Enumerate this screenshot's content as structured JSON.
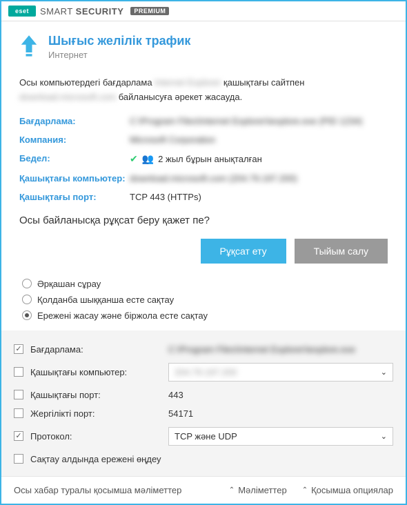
{
  "titlebar": {
    "eset": "eset",
    "brand_plain": "SMART ",
    "brand_bold": "SECURITY",
    "premium": "PREMIUM"
  },
  "header": {
    "title": "Шығыс желілік трафик",
    "subtitle": "Интернет"
  },
  "description": {
    "part1": "Осы компьютердегі бағдарлама ",
    "app_blurred": "Internet Explorer",
    "part2": " қашықтағы сайтпен ",
    "site_blurred": "download.microsoft.com",
    "part3": " байланысуға әрекет жасауда."
  },
  "info": {
    "app_label": "Бағдарлама:",
    "app_value": "C:\\Program Files\\Internet Explorer\\iexplore.exe (PID 1234)",
    "company_label": "Компания:",
    "company_value": "Microsoft Corporation",
    "rep_label": "Бедел:",
    "rep_value": "2 жыл бұрын анықталған",
    "remote_comp_label": "Қашықтағы компьютер:",
    "remote_comp_value": "download.microsoft.com (204.79.197.200)",
    "remote_port_label": "Қашықтағы порт:",
    "remote_port_value": "TCP 443 (HTTPs)"
  },
  "question": "Осы байланысқа рұқсат беру қажет пе?",
  "buttons": {
    "allow": "Рұқсат ету",
    "deny": "Тыйым салу"
  },
  "radios": {
    "always_ask": "Әрқашан сұрау",
    "until_quit": "Қолданба шыққанша есте сақтау",
    "create_rule": "Ережені жасау және біржола есте сақтау"
  },
  "rule": {
    "app_label": "Бағдарлама:",
    "app_value": "C:\\Program Files\\Internet Explorer\\iexplore.exe",
    "remote_comp_label": "Қашықтағы компьютер:",
    "remote_comp_value": "204.79.197.200",
    "remote_port_label": "Қашықтағы порт:",
    "remote_port_value": "443",
    "local_port_label": "Жергілікті порт:",
    "local_port_value": "54171",
    "protocol_label": "Протокол:",
    "protocol_value": "TCP және UDP",
    "edit_before_save": "Сақтау алдында ережені өңдеу"
  },
  "footer": {
    "more_info": "Осы хабар туралы қосымша мәліметтер",
    "details": "Мәліметтер",
    "extra": "Қосымша опциялар"
  }
}
